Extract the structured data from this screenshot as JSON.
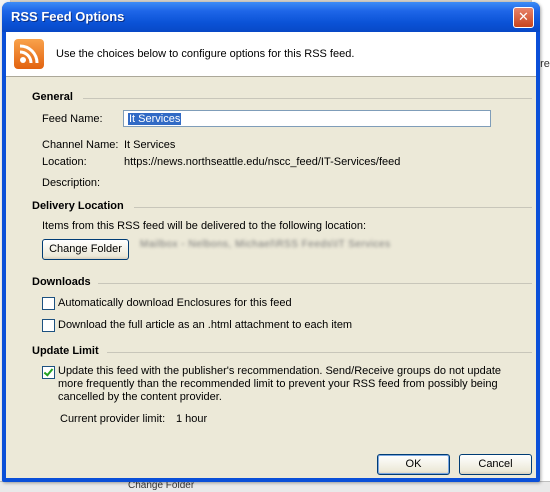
{
  "window": {
    "title": "RSS Feed Options"
  },
  "header": {
    "icon": "rss-icon",
    "text": "Use the choices below to configure options for this RSS feed."
  },
  "general": {
    "heading": "General",
    "feed_name_label": "Feed Name:",
    "feed_name_value": "It Services",
    "channel_name_label": "Channel Name:",
    "channel_name_value": "It Services",
    "location_label": "Location:",
    "location_value": "https://news.northseattle.edu/nscc_feed/IT-Services/feed",
    "description_label": "Description:"
  },
  "delivery": {
    "heading": "Delivery Location",
    "text": "Items from this RSS feed will be delivered to the following location:",
    "change_folder_label": "Change Folder",
    "path_value": "Mailbox - Nelbons, Michael\\RSS Feeds\\IT Services"
  },
  "downloads": {
    "heading": "Downloads",
    "items": [
      {
        "label": "Automatically download Enclosures for this feed",
        "checked": false
      },
      {
        "label": "Download the full article as an .html attachment to each item",
        "checked": false
      }
    ]
  },
  "update_limit": {
    "heading": "Update Limit",
    "checked": true,
    "text": "Update this feed with the publisher's recommendation. Send/Receive groups do not update more frequently than the recommended limit to prevent your RSS feed from possibly being cancelled by the content provider.",
    "provider_limit_label": "Current provider limit:",
    "provider_limit_value": "1 hour"
  },
  "buttons": {
    "ok": "OK",
    "cancel": "Cancel"
  },
  "background": {
    "right_fragment": "dre",
    "bottom_fragment": "Change Folder"
  }
}
